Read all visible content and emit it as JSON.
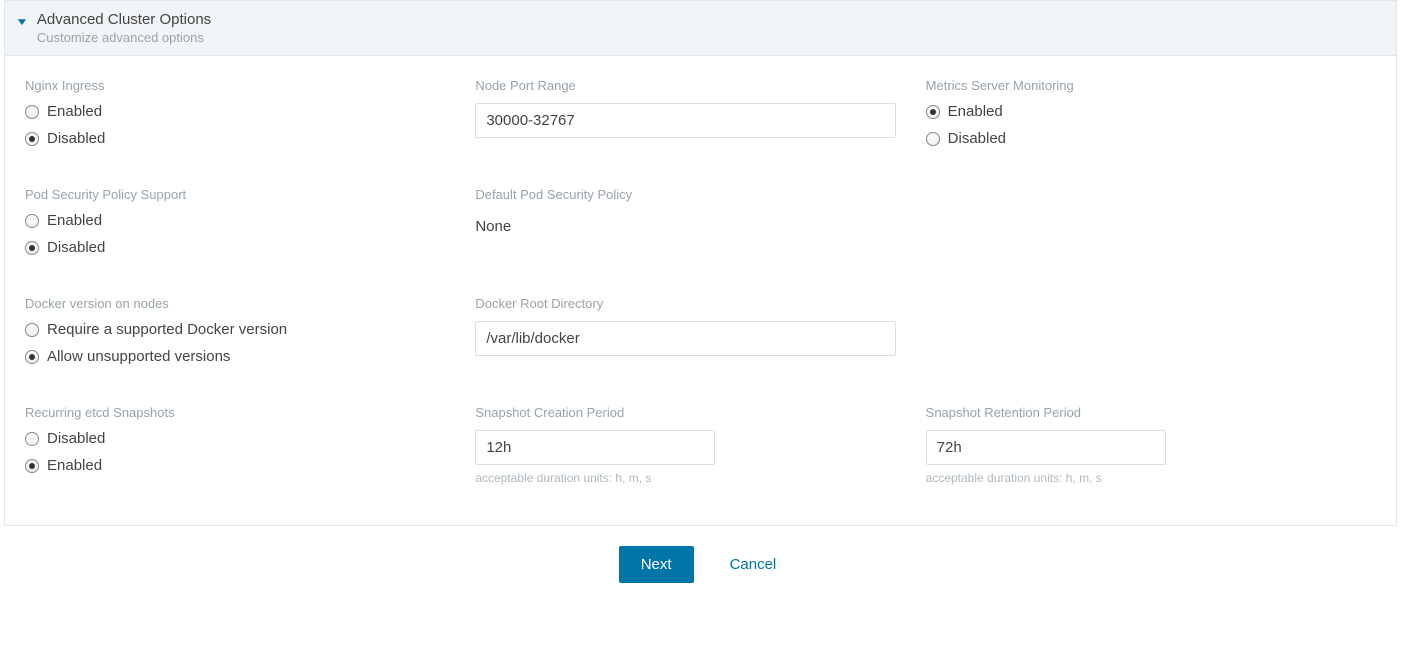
{
  "panel": {
    "title": "Advanced Cluster Options",
    "subtitle": "Customize advanced options"
  },
  "nginxIngress": {
    "label": "Nginx Ingress",
    "enabled": "Enabled",
    "disabled": "Disabled",
    "selected": "disabled"
  },
  "nodePortRange": {
    "label": "Node Port Range",
    "value": "30000-32767"
  },
  "metricsServer": {
    "label": "Metrics Server Monitoring",
    "enabled": "Enabled",
    "disabled": "Disabled",
    "selected": "enabled"
  },
  "podSecurity": {
    "label": "Pod Security Policy Support",
    "enabled": "Enabled",
    "disabled": "Disabled",
    "selected": "disabled"
  },
  "defaultPodPolicy": {
    "label": "Default Pod Security Policy",
    "value": "None"
  },
  "dockerVersion": {
    "label": "Docker version on nodes",
    "require": "Require a supported Docker version",
    "allow": "Allow unsupported versions",
    "selected": "allow"
  },
  "dockerRoot": {
    "label": "Docker Root Directory",
    "value": "/var/lib/docker"
  },
  "etcdSnapshots": {
    "label": "Recurring etcd Snapshots",
    "disabled": "Disabled",
    "enabled": "Enabled",
    "selected": "enabled"
  },
  "snapshotCreation": {
    "label": "Snapshot Creation Period",
    "value": "12h",
    "hint": "acceptable duration units: h, m, s"
  },
  "snapshotRetention": {
    "label": "Snapshot Retention Period",
    "value": "72h",
    "hint": "acceptable duration units: h, m, s"
  },
  "footer": {
    "next": "Next",
    "cancel": "Cancel"
  }
}
